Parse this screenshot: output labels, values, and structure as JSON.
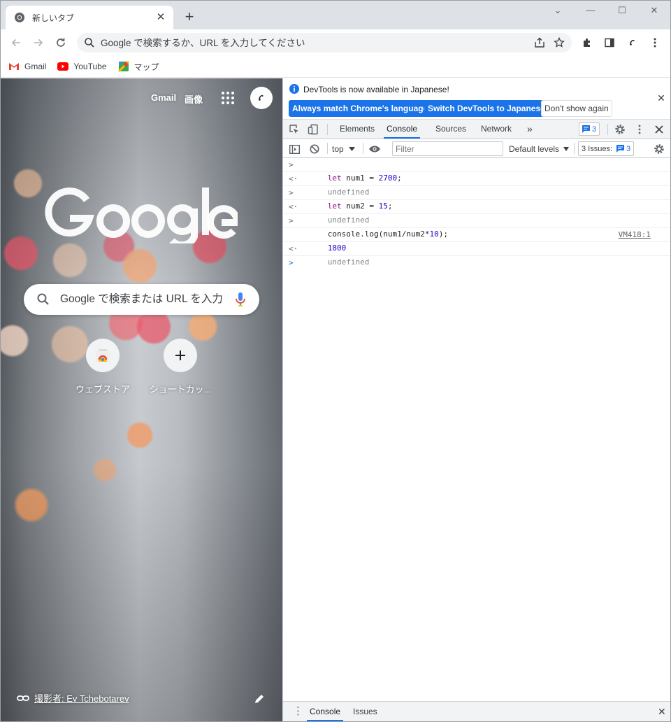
{
  "tab": {
    "title": "新しいタブ",
    "close": "✕"
  },
  "new_tab": "+",
  "window": {
    "minimize": "—",
    "maximize": "☐",
    "close": "✕",
    "tab_search": "⌄"
  },
  "omnibox": {
    "placeholder": "Google で検索するか、URL を入力してください"
  },
  "bookmarks": [
    {
      "label": "Gmail",
      "icon": "gmail-icon"
    },
    {
      "label": "YouTube",
      "icon": "youtube-icon"
    },
    {
      "label": "マップ",
      "icon": "maps-icon"
    }
  ],
  "ntp": {
    "gmail_link": "Gmail",
    "images_link": "画像",
    "search_placeholder": "Google で検索または URL を入力",
    "shortcuts": [
      {
        "label": "ウェブストア",
        "icon": "webstore-icon"
      },
      {
        "label": "ショートカッ...",
        "icon": "add-icon"
      }
    ],
    "photo_credit": "撮影者: Ev Tchebotarev"
  },
  "devtools": {
    "infobar": {
      "message": "DevTools is now available in Japanese!",
      "btn_match": "Always match Chrome's language",
      "btn_switch": "Switch DevTools to Japanese",
      "btn_dismiss": "Don't show again",
      "close": "✕"
    },
    "tabs": [
      "Elements",
      "Console",
      "Sources",
      "Network"
    ],
    "more_tabs": "»",
    "active_tab": "Console",
    "issues_badge_count": "3",
    "console_toolbar": {
      "context": "top",
      "filter_placeholder": "Filter",
      "levels": "Default levels",
      "issues_label": "3 Issues:",
      "issues_count": "3"
    },
    "console_lines": [
      {
        "type": "input",
        "gutter": ">",
        "kw": "let",
        "rest": " num1 = ",
        "num": "2700",
        "end": ";"
      },
      {
        "type": "result",
        "gutter": "<·",
        "text": "undefined"
      },
      {
        "type": "input",
        "gutter": ">",
        "kw": "let",
        "rest": " num2 = ",
        "num": "15",
        "end": ";"
      },
      {
        "type": "result",
        "gutter": "<·",
        "text": "undefined"
      },
      {
        "type": "input2",
        "gutter": ">",
        "pre": "console.log(num1/num2*",
        "num": "10",
        "end": ");"
      },
      {
        "type": "log",
        "text": "1800",
        "source": "VM418:1"
      },
      {
        "type": "result",
        "gutter": "<·",
        "text": "undefined"
      }
    ],
    "prompt_gutter": ">",
    "drawer": {
      "tabs": [
        "Console",
        "Issues"
      ],
      "close": "✕",
      "menu": "⋮"
    }
  },
  "colors": {
    "accent": "#1a73e8",
    "tab_strip": "#dee1e6",
    "devtools_toolbar": "#f1f3f4"
  }
}
